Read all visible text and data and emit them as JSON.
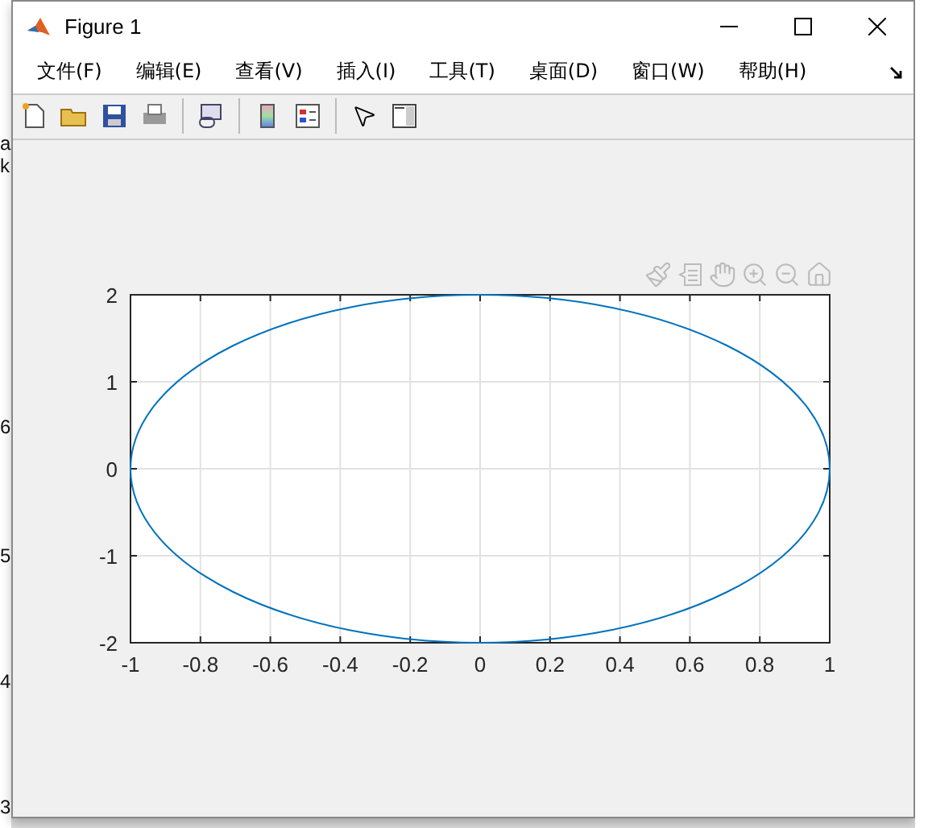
{
  "background_window": {
    "side_labels": [
      "a",
      "k",
      "6",
      "5",
      "4",
      "3"
    ]
  },
  "window": {
    "title": "Figure 1"
  },
  "menu": [
    "文件(F)",
    "编辑(E)",
    "查看(V)",
    "插入(I)",
    "工具(T)",
    "桌面(D)",
    "窗口(W)",
    "帮助(H)"
  ],
  "axes": {
    "chart_data": {
      "type": "line",
      "grid": true,
      "xlim": [
        -1,
        1
      ],
      "ylim": [
        -2,
        2
      ],
      "xticks": [
        -1,
        -0.8,
        -0.6,
        -0.4,
        -0.2,
        0,
        0.2,
        0.4,
        0.6,
        0.8,
        1
      ],
      "yticks": [
        -2,
        -1,
        0,
        1,
        2
      ]
    }
  }
}
